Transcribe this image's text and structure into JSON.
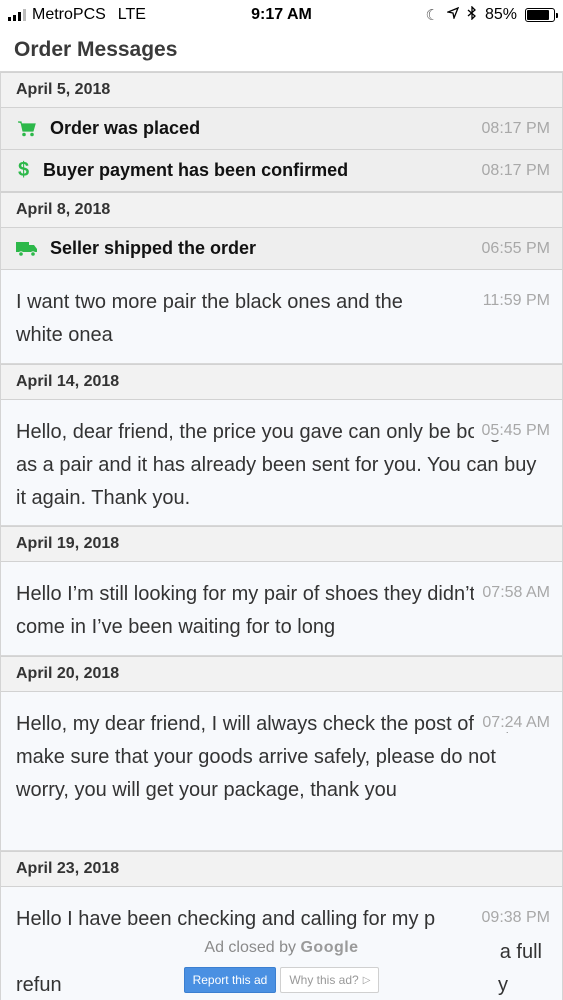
{
  "status_bar": {
    "carrier": "MetroPCS",
    "network": "LTE",
    "time": "9:17 AM",
    "battery_text": "85%",
    "battery_level": 0.85
  },
  "header": {
    "title": "Order Messages"
  },
  "colors": {
    "accent_green": "#2db84a",
    "report_blue": "#4a90e2"
  },
  "groups": [
    {
      "date": "April 5, 2018",
      "events": [
        {
          "icon": "cart-icon",
          "text": "Order was placed",
          "time": "08:17 PM"
        },
        {
          "icon": "dollar-icon",
          "text": "Buyer payment has been confirmed",
          "time": "08:17 PM"
        }
      ]
    },
    {
      "date": "April 8, 2018",
      "events": [
        {
          "icon": "truck-icon",
          "text": "Seller shipped the order",
          "time": "06:55 PM"
        }
      ],
      "messages": [
        {
          "text": "I want two more pair the black ones and the white onea",
          "time": "11:59 PM"
        }
      ]
    },
    {
      "date": "April 14, 2018",
      "messages": [
        {
          "text": "Hello, dear friend, the price you gave can only be bought as a pair and it has already been sent for you. You can buy it again. Thank you.",
          "time": "05:45 PM"
        }
      ]
    },
    {
      "date": "April 19, 2018",
      "messages": [
        {
          "text": "Hello I’m still looking for my pair of shoes they didn’t come in I’ve been waiting for to long",
          "time": "07:58 AM"
        }
      ]
    },
    {
      "date": "April 20, 2018",
      "messages": [
        {
          "text": "Hello, my dear friend, I will always check the post office, make sure that your goods arrive safely, please do not worry, you will get your package, thank you",
          "time": "07:24 AM"
        }
      ]
    },
    {
      "date": "April 23, 2018",
      "messages": [
        {
          "text": "Hello I have been checking and calling for my p",
          "text_line2_end": "a full",
          "text_line3_start": "refun",
          "text_line3_end": "y",
          "time": "09:38 PM"
        }
      ]
    }
  ],
  "ad": {
    "closed_prefix": "Ad closed by",
    "closed_brand": "Google",
    "report_label": "Report this ad",
    "why_label": "Why this ad?"
  }
}
